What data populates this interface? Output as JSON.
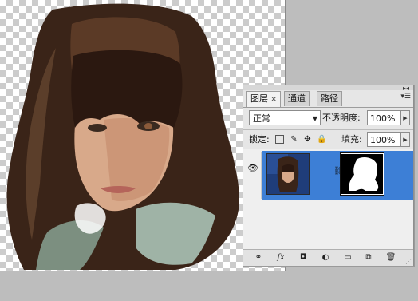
{
  "layers_panel": {
    "tabs": [
      {
        "label": "图层",
        "close": "×"
      },
      {
        "label": "通道"
      },
      {
        "label": "路径"
      }
    ],
    "blend_mode": "正常",
    "opacity_label": "不透明度:",
    "opacity_value": "100%",
    "lock_label": "锁定:",
    "fill_label": "填充:",
    "fill_value": "100%",
    "layer": {
      "visible": true
    }
  },
  "icons": {
    "panel_menu": "panel-menu-icon",
    "eye": "eye-icon",
    "lock": [
      "lock-transparent-icon",
      "lock-paint-icon",
      "lock-move-icon",
      "lock-all-icon"
    ],
    "bottom": [
      "link-layers-icon",
      "fx-icon",
      "add-mask-icon",
      "adjustment-layer-icon",
      "new-group-icon",
      "new-layer-icon",
      "trash-icon"
    ]
  },
  "colors": {
    "selected_layer": "#3d7fd6",
    "workspace": "#bdbdbd",
    "panel_bg": "#e6e6e6"
  }
}
